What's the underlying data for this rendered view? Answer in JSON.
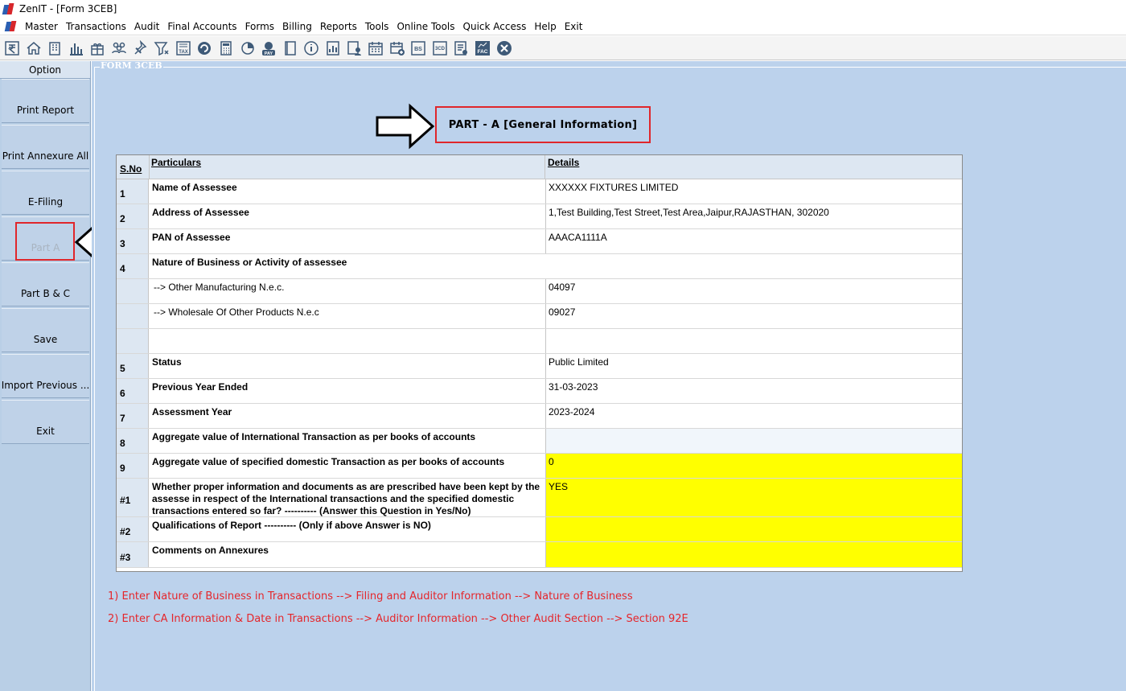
{
  "window": {
    "title": "ZenIT - [Form 3CEB]"
  },
  "menu": [
    "Master",
    "Transactions",
    "Audit",
    "Final Accounts",
    "Forms",
    "Billing",
    "Reports",
    "Tools",
    "Online Tools",
    "Quick Access",
    "Help",
    "Exit"
  ],
  "toolbar": {
    "icons": [
      "rupee-icon",
      "home-icon",
      "building-icon",
      "bar-chart-icon",
      "gift-icon",
      "users-icon",
      "pin-icon",
      "filter-icon",
      "tax-icon",
      "refresh-icon",
      "calculator-icon",
      "pie-chart-icon",
      "pay-icon",
      "book-icon",
      "info-icon",
      "report-icon",
      "person-doc-icon",
      "calendar-icon",
      "calendar-add-icon",
      "bs-icon",
      "3cd-icon",
      "audit-icon",
      "fac-icon",
      "close-circle-icon"
    ],
    "tax_label": "TAX",
    "pay_label": "PAY",
    "bs_label": "BS",
    "cd_label": "3CD",
    "fac_label": "FAC"
  },
  "sidebar": {
    "header": "Option",
    "buttons": [
      {
        "label": "Print Report",
        "enabled": true
      },
      {
        "label": "Print Annexure All",
        "enabled": true
      },
      {
        "label": "E-Filing",
        "enabled": true
      },
      {
        "label": "Part A",
        "enabled": false
      },
      {
        "label": "Part B & C",
        "enabled": true
      },
      {
        "label": "Save",
        "enabled": true
      },
      {
        "label": "Import Previous ...",
        "enabled": true
      },
      {
        "label": "Exit",
        "enabled": true
      }
    ]
  },
  "form": {
    "group_label": "FORM 3CEB",
    "part_title": "PART - A [General  Information]",
    "table": {
      "headers": {
        "sno": "S.No",
        "particulars": "Particulars",
        "details": "Details"
      },
      "rows": [
        {
          "sno": "1",
          "particulars": "Name of Assessee",
          "details": "XXXXXX FIXTURES LIMITED"
        },
        {
          "sno": "2",
          "particulars": "Address of Assessee",
          "details": "1,Test Building,Test Street,Test Area,Jaipur,RAJASTHAN, 302020"
        },
        {
          "sno": "3",
          "particulars": "PAN of Assessee",
          "details": "AAACA1111A"
        },
        {
          "sno": "4",
          "particulars": "Nature of Business or Activity of assessee",
          "details": ""
        },
        {
          "sno": "",
          "particulars": "--> Other Manufacturing N.e.c.",
          "details": "04097"
        },
        {
          "sno": "",
          "particulars": "--> Wholesale Of Other Products N.e.c",
          "details": "09027"
        },
        {
          "sno": "",
          "particulars": "",
          "details": ""
        },
        {
          "sno": "5",
          "particulars": "Status",
          "details": "Public Limited"
        },
        {
          "sno": "6",
          "particulars": "Previous Year Ended",
          "details": "31-03-2023"
        },
        {
          "sno": "7",
          "particulars": "Assessment Year",
          "details": "2023-2024"
        },
        {
          "sno": "8",
          "particulars": "Aggregate value of International Transaction as per books of accounts",
          "details": ""
        },
        {
          "sno": "9",
          "particulars": "Aggregate value of specified domestic Transaction as per books of accounts",
          "details": "0"
        },
        {
          "sno": "#1",
          "particulars": "Whether proper information and documents as are prescribed have been kept by the assesse in respect of the International transactions and the specified domestic transactions entered so far? ---------- (Answer this Question in Yes/No)",
          "details": "YES"
        },
        {
          "sno": "#2",
          "particulars": "Qualifications of Report ---------- (Only if above Answer is NO)",
          "details": ""
        },
        {
          "sno": "#3",
          "particulars": "Comments on Annexures",
          "details": ""
        }
      ]
    },
    "notes": [
      "1) Enter Nature of Business in Transactions --> Filing and Auditor Information --> Nature of Business",
      "2) Enter CA Information & Date in Transactions --> Auditor Information --> Other Audit Section --> Section 92E"
    ]
  },
  "colors": {
    "highlight_red": "#e0262b",
    "input_yellow": "#ffff00",
    "panel_blue": "#bcd2ec"
  }
}
